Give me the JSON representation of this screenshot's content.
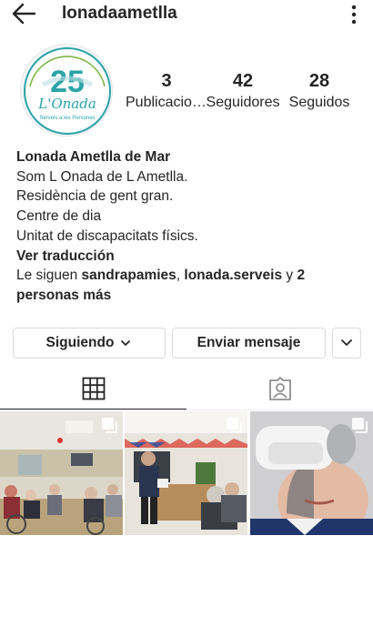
{
  "header": {
    "username": "lonadaametlla"
  },
  "avatar": {
    "badge_number": "25",
    "brand_name": "L'Onada",
    "tagline": "Serveis a les Persones"
  },
  "stats": [
    {
      "value": "3",
      "label": "Publicaciones"
    },
    {
      "value": "42",
      "label": "Seguidores"
    },
    {
      "value": "28",
      "label": "Seguidos"
    }
  ],
  "bio": {
    "name": "Lonada Ametlla de Mar",
    "lines": [
      "Som L Onada de L Ametlla.",
      "Residència de gent gran.",
      "Centre de dia",
      "Unitat de discapacitats físics."
    ],
    "translate_link": "Ver traducción",
    "followed_by_prefix": "Le siguen ",
    "followed_by_user1": "sandrapamies",
    "followed_by_sep": ", ",
    "followed_by_user2": "lonada.serveis",
    "followed_by_and": " y ",
    "followed_by_more": "2 personas más"
  },
  "buttons": {
    "following": "Siguiendo",
    "message": "Enviar mensaje"
  },
  "tabs": [
    "grid",
    "tagged"
  ],
  "icons": {
    "back": "arrow-left-icon",
    "more": "more-vertical-icon",
    "chevron": "chevron-down-icon",
    "grid": "grid-icon",
    "tagged": "person-tag-icon",
    "multi": "multiple-photos-icon"
  },
  "colors": {
    "text": "#262626",
    "border": "#dbdbdb",
    "brand_teal": "#2aa3a7",
    "brand_green": "#7fb84a"
  }
}
